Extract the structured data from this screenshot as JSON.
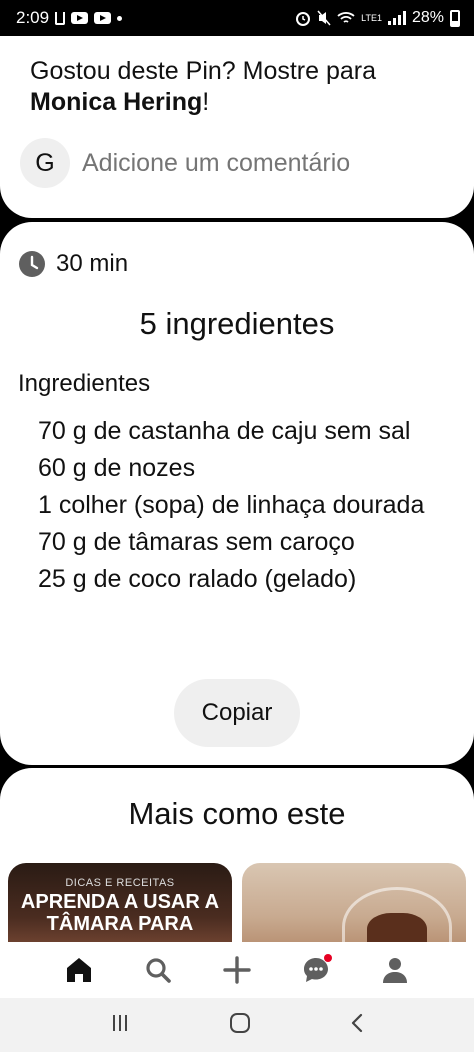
{
  "status_bar": {
    "time": "2:09",
    "network": "LTE1",
    "battery": "28%"
  },
  "comment_card": {
    "prompt_text": "Gostou deste Pin? Mostre para",
    "creator_name": "Monica Hering",
    "prompt_suffix": "!",
    "avatar_initial": "G",
    "comment_placeholder": "Adicione um comentário"
  },
  "recipe": {
    "time": "30 min",
    "ingredient_count": "5 ingredientes",
    "section_title": "Ingredientes",
    "ingredients": [
      "70 g de castanha de caju sem sal",
      "60 g de nozes",
      "1 colher (sopa) de linhaça dourada",
      "70 g de tâmaras sem caroço",
      "25 g de coco ralado (gelado)"
    ],
    "copy_label": "Copiar"
  },
  "more_like_this": {
    "title": "Mais como este",
    "pins": [
      {
        "tag": "DICAS E RECEITAS",
        "headline": "APRENDA A USAR A TÂMARA PARA"
      },
      {
        "tag": "",
        "headline": ""
      }
    ]
  },
  "bottom_nav": {
    "items": [
      "home-icon",
      "search-icon",
      "create-icon",
      "messages-icon",
      "profile-icon"
    ]
  },
  "colors": {
    "notification": "#e60023",
    "text": "#111111",
    "muted": "#8e8e8e"
  }
}
